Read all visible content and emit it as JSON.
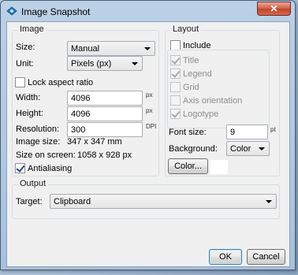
{
  "window": {
    "title": "Image Snapshot",
    "close_label": "✕"
  },
  "image_group": {
    "legend": "Image",
    "size_label": "Size:",
    "size_value": "Manual",
    "unit_label": "Unit:",
    "unit_value": "Pixels (px)",
    "lock_aspect_label": "Lock aspect ratio",
    "lock_aspect_checked": false,
    "width_label": "Width:",
    "width_value": "4096",
    "width_unit": "px",
    "height_label": "Height:",
    "height_value": "4096",
    "height_unit": "px",
    "resolution_label": "Resolution:",
    "resolution_value": "300",
    "resolution_unit": "DPI",
    "image_size_label": "Image size:",
    "image_size_value": "347 x 347 mm",
    "size_on_screen_label": "Size on screen:",
    "size_on_screen_value": "1058 x 928 px",
    "antialiasing_label": "Antialiasing",
    "antialiasing_checked": true
  },
  "layout_group": {
    "legend": "Layout",
    "include_label": "Include",
    "include_checked": false,
    "items": [
      {
        "label": "Title",
        "checked": true
      },
      {
        "label": "Legend",
        "checked": true
      },
      {
        "label": "Grid",
        "checked": false
      },
      {
        "label": "Axis orientation",
        "checked": false
      },
      {
        "label": "Logotype",
        "checked": true
      }
    ],
    "font_size_label": "Font size:",
    "font_size_value": "9",
    "font_size_unit": "pt",
    "background_label": "Background:",
    "background_value": "Color",
    "color_button": "Color...",
    "swatch_color": "#ffffff"
  },
  "output_group": {
    "legend": "Output",
    "target_label": "Target:",
    "target_value": "Clipboard"
  },
  "buttons": {
    "ok": "OK",
    "cancel": "Cancel"
  }
}
